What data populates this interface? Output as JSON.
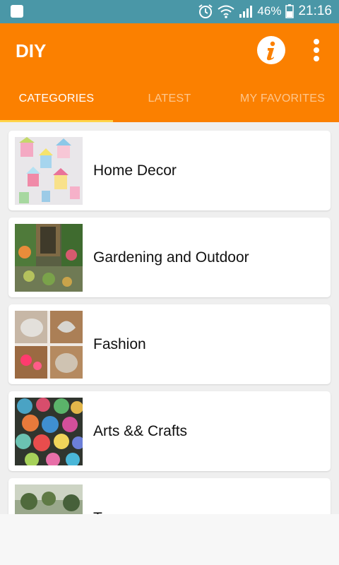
{
  "status_bar": {
    "battery": "46%",
    "clock": "21:16",
    "icons": [
      "alarm-icon",
      "wifi-icon",
      "signal-icon",
      "battery-icon"
    ]
  },
  "app_bar": {
    "title": "DIY",
    "info_icon": "info-icon",
    "menu_icon": "more-vert-icon"
  },
  "tabs": [
    {
      "label": "CATEGORIES",
      "active": true
    },
    {
      "label": "LATEST",
      "active": false
    },
    {
      "label": "MY FAVORITES",
      "active": false
    }
  ],
  "categories": [
    {
      "label": "Home Decor"
    },
    {
      "label": "Gardening and Outdoor"
    },
    {
      "label": "Fashion"
    },
    {
      "label": "Arts && Crafts"
    },
    {
      "label": "Tr..."
    }
  ],
  "colors": {
    "status_bar": "#4a97a7",
    "accent": "#fb8000",
    "tab_indicator": "#ffd54a"
  }
}
